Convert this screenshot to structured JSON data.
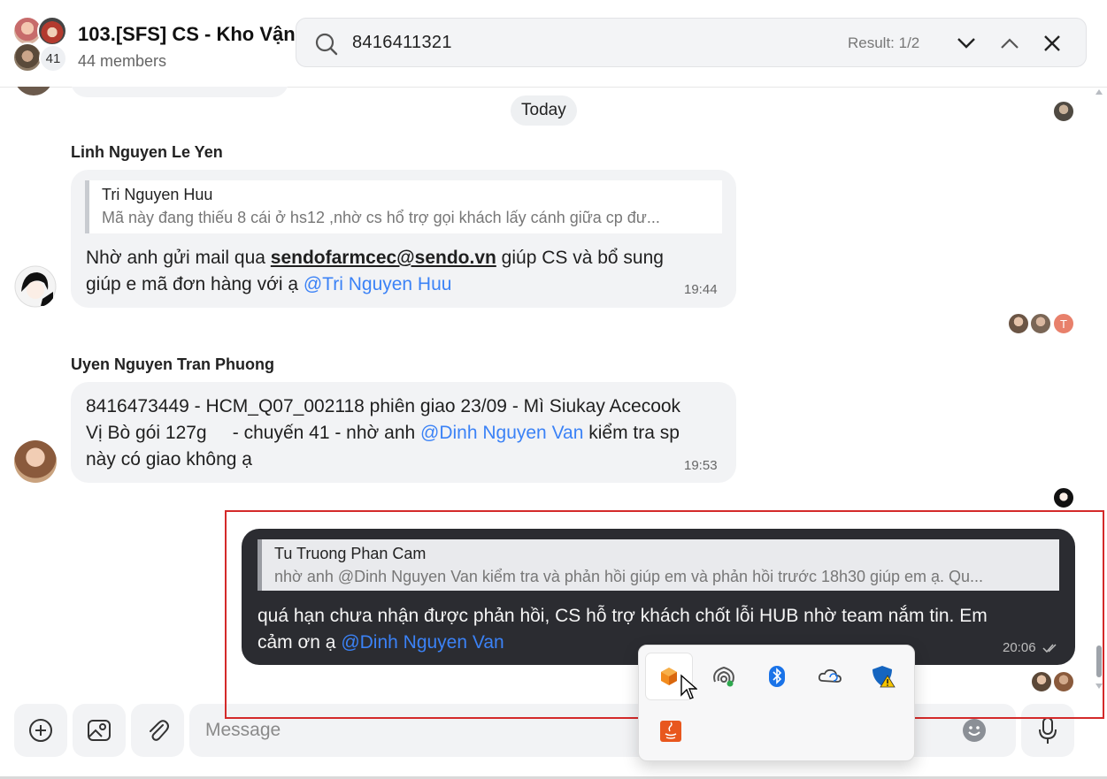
{
  "header": {
    "title": "103.[SFS] CS - Kho Vận",
    "members": "44 members",
    "avatar_count": "41"
  },
  "search": {
    "query": "8416411321",
    "result": "Result: 1/2"
  },
  "chat": {
    "date_divider": "Today",
    "messages": [
      {
        "sender": "Linh Nguyen Le Yen",
        "quote_name": "Tri Nguyen Huu",
        "quote_text": "Mã này đang thiếu 8 cái ở hs12 ,nhờ cs hổ trợ gọi khách lấy cánh giữa cp đư...",
        "line1_pre": "Nhờ anh gửi mail qua ",
        "email": "sendofarmcec@sendo.vn",
        "line1_post": " giúp CS và bổ sung",
        "line2_pre": "giúp e mã đơn hàng với ạ ",
        "mention": "@Tri Nguyen Huu",
        "time": "19:44"
      },
      {
        "sender": "Uyen Nguyen Tran Phuong",
        "line1": "8416473449 - HCM_Q07_002118 phiên giao 23/09 - Mì Siukay Acecook",
        "line2_pre": "Vị Bò gói 127g     - chuyến 41 - nhờ anh ",
        "mention": "@Dinh Nguyen Van",
        "line2_post": " kiểm tra sp",
        "line3": "này có giao không ạ",
        "time": "19:53"
      },
      {
        "quote_name": "Tu Truong Phan Cam",
        "quote_text": "nhờ anh @Dinh Nguyen Van kiểm tra và phản hồi giúp em và phản hồi trước 18h30 giúp em ạ. Qu...",
        "line1": "quá hạn chưa nhận được phản hồi, CS hỗ trợ khách chốt lỗi HUB nhờ team nắm tin. Em",
        "line2_pre": "cảm ơn ạ ",
        "mention": "@Dinh Nguyen Van",
        "time": "20:06",
        "status_icon": "double-check-icon"
      }
    ],
    "seen_avatar_letter": "T"
  },
  "composer": {
    "placeholder": "Message"
  },
  "tray": {
    "icons": [
      "orange-app-icon",
      "network-icon",
      "bluetooth-icon",
      "onedrive-icon",
      "security-warning-icon",
      "java-icon"
    ]
  },
  "colors": {
    "mention": "#3b82f6",
    "highlight_border": "#d42a2a",
    "own_bubble": "#2b2c31"
  }
}
